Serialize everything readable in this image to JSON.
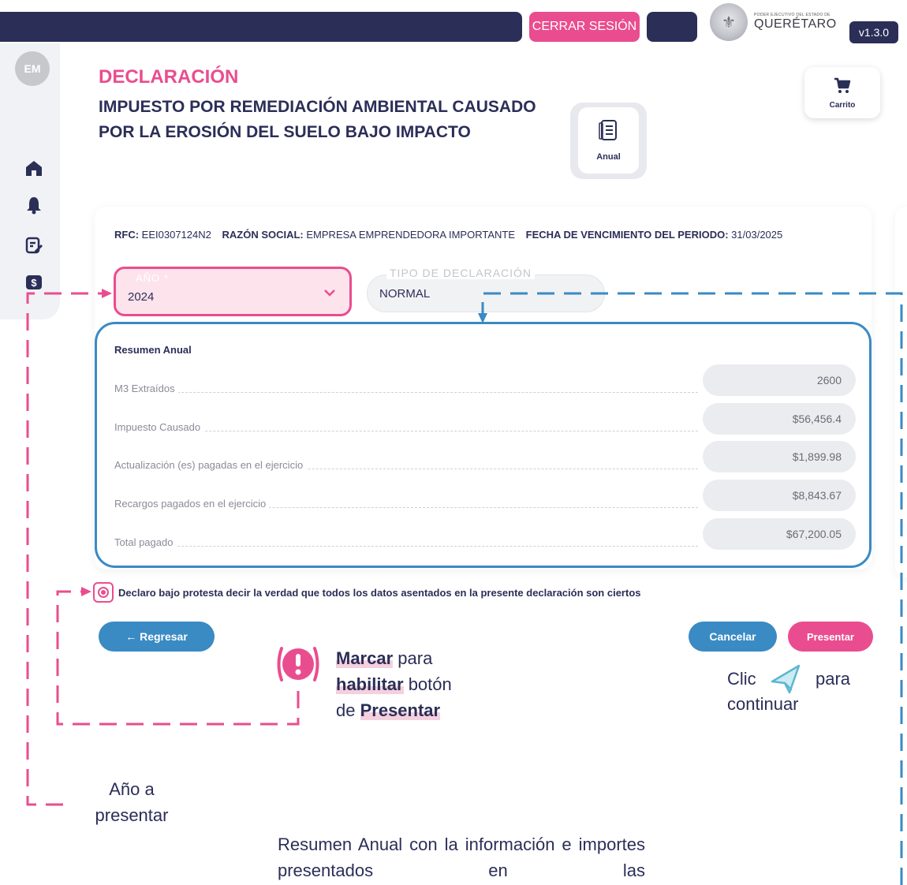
{
  "header": {
    "logout_label": "CERRAR SESIÓN",
    "logo_small_text": "PODER EJECUTIVO DEL ESTADO DE",
    "logo_text": "QUERÉTARO",
    "version": "v1.3.0"
  },
  "sidebar": {
    "avatar_initials": "EM",
    "items": [
      {
        "icon": "home-icon"
      },
      {
        "icon": "bell-icon"
      },
      {
        "icon": "edit-document-icon"
      },
      {
        "icon": "payment-icon"
      }
    ]
  },
  "page": {
    "title": "DECLARACIÓN",
    "subtitle": "IMPUESTO POR REMEDIACIÓN AMBIENTAL CAUSADO POR LA EROSIÓN DEL SUELO BAJO IMPACTO",
    "annual_label": "Anual",
    "cart_label": "Carrito"
  },
  "info": {
    "rfc_label": "RFC:",
    "rfc_value": "EEI0307124N2",
    "razon_label": "RAZÓN SOCIAL:",
    "razon_value": "EMPRESA EMPRENDEDORA IMPORTANTE",
    "fecha_label": "FECHA DE VENCIMIENTO DEL PERIODO:",
    "fecha_value": "31/03/2025"
  },
  "form": {
    "year_label": "AÑO *",
    "year_value": "2024",
    "type_label": "TIPO DE DECLARACIÓN",
    "type_value": "NORMAL"
  },
  "summary": {
    "title": "Resumen Anual",
    "rows": [
      {
        "label": "M3 Extraídos",
        "value": "2600"
      },
      {
        "label": "Impuesto Causado",
        "value": "$56,456.4"
      },
      {
        "label": "Actualización (es) pagadas en el ejercicio",
        "value": "$1,899.98"
      },
      {
        "label": "Recargos pagados en el ejercicio",
        "value": "$8,843.67"
      },
      {
        "label": "Total pagado",
        "value": "$67,200.05"
      }
    ]
  },
  "declaration": {
    "text": "Declaro bajo protesta decir la verdad que todos los datos asentados en la presente declaración son ciertos",
    "checked": true
  },
  "buttons": {
    "back": "← Regresar",
    "cancel": "Cancelar",
    "present": "Presentar"
  },
  "annotations": {
    "mark_1": "Marcar",
    "mark_2": " para",
    "mark_3": "habilitar",
    "mark_4": " botón",
    "mark_5": "de ",
    "mark_6": "Presentar",
    "click_1": "Clic",
    "click_2": "para",
    "click_3": "continuar",
    "year_note": "Año a presentar",
    "summary_note": "Resumen Anual con la información e importes presentados en las"
  },
  "colors": {
    "navy": "#2b2e57",
    "pink": "#e94d8f",
    "blue": "#3a8ac4"
  }
}
